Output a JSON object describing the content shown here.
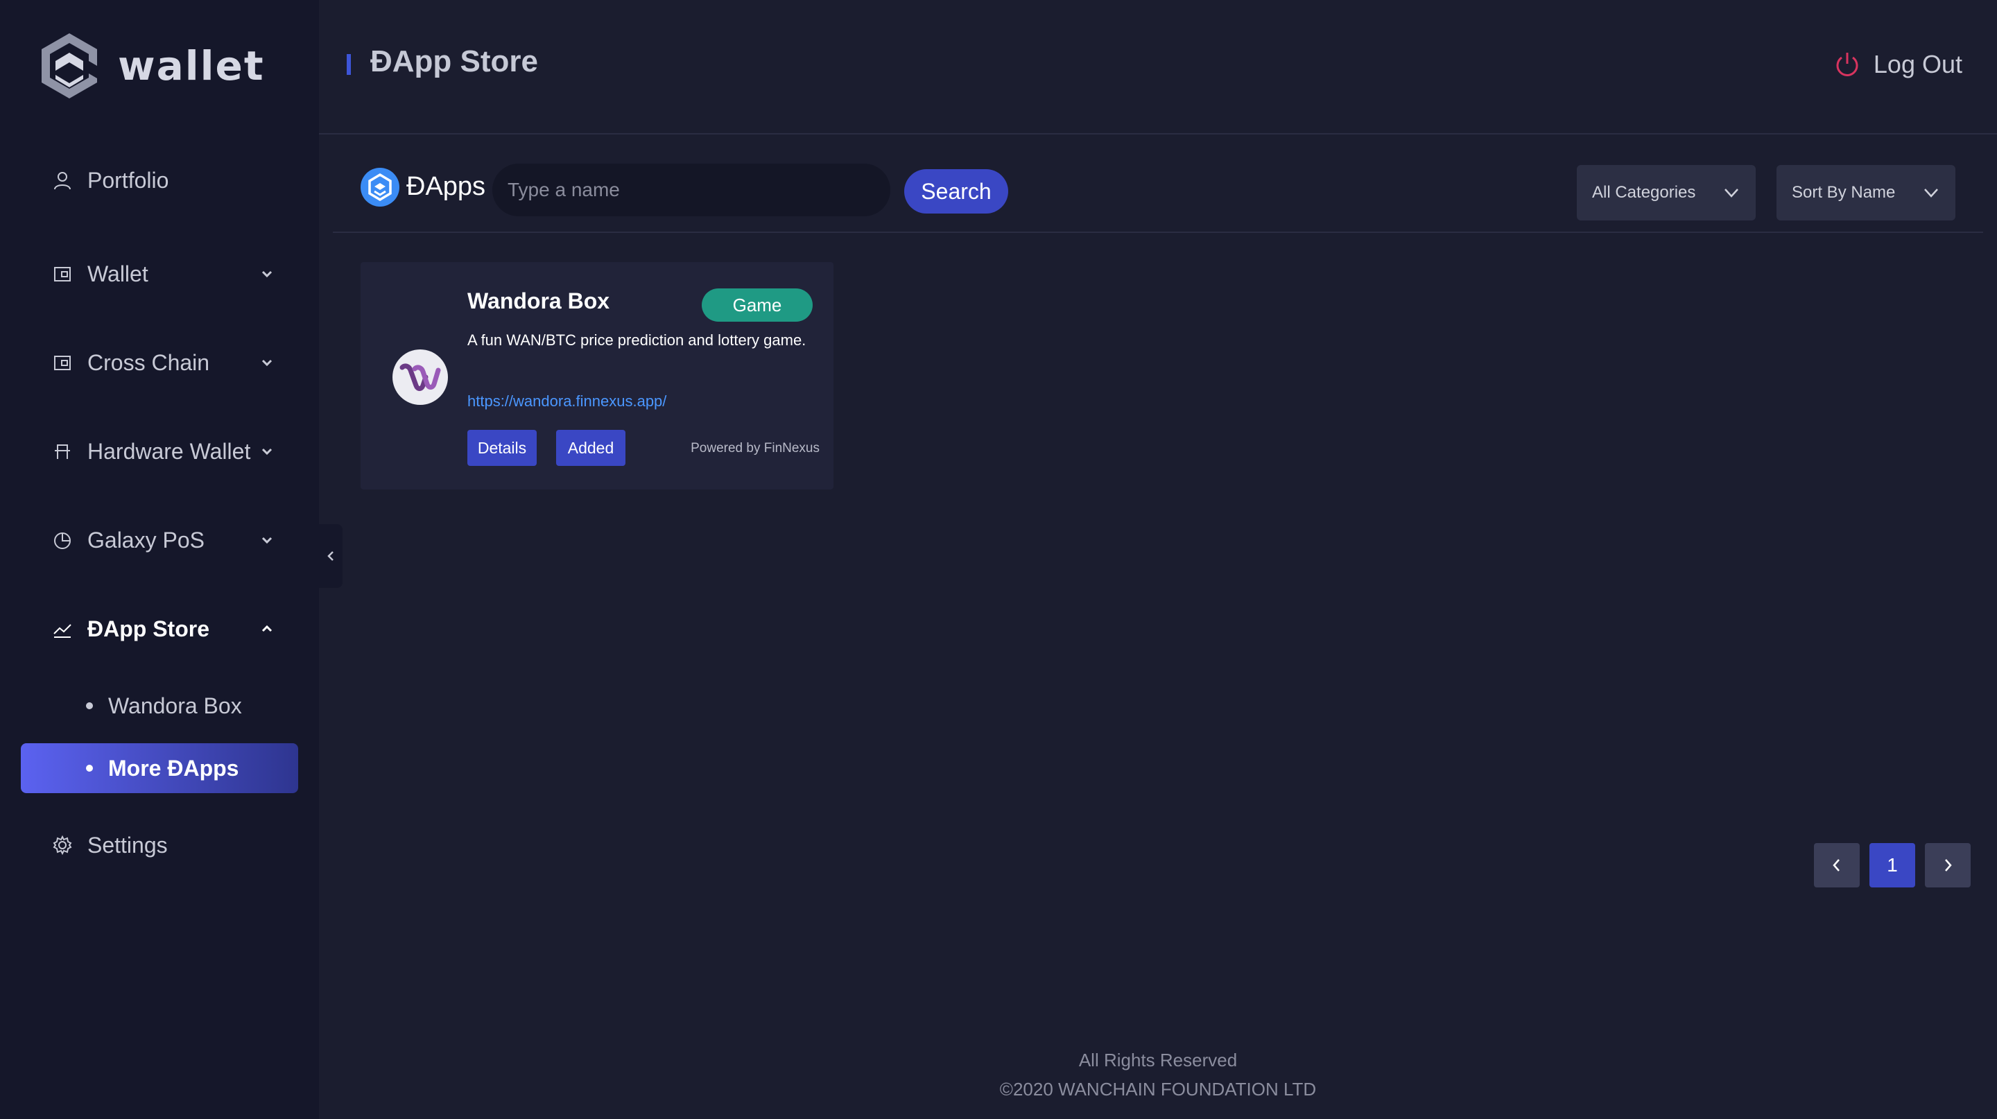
{
  "brand": {
    "name": "wallet"
  },
  "sidebar": {
    "items": [
      {
        "label": "Portfolio",
        "icon": "user-icon"
      },
      {
        "label": "Wallet",
        "icon": "wallet-icon",
        "expanded": false
      },
      {
        "label": "Cross Chain",
        "icon": "cross-chain-icon",
        "expanded": false
      },
      {
        "label": "Hardware Wallet",
        "icon": "hardware-icon",
        "expanded": false
      },
      {
        "label": "Galaxy PoS",
        "icon": "pie-chart-icon",
        "expanded": false
      },
      {
        "label": "ĐApp Store",
        "icon": "chart-line-icon",
        "expanded": true
      },
      {
        "label": "Settings",
        "icon": "gear-icon"
      }
    ],
    "subitems": [
      {
        "label": "Wandora Box",
        "active": false
      },
      {
        "label": "More ĐApps",
        "active": true
      }
    ]
  },
  "header": {
    "title": "ĐApp Store",
    "logout_label": "Log Out"
  },
  "toolbar": {
    "section_label": "ĐApps",
    "search_placeholder": "Type a name",
    "search_value": "",
    "search_button": "Search",
    "category_select": "All Categories",
    "sort_select": "Sort By Name"
  },
  "dapps": [
    {
      "name": "Wandora Box",
      "tag": "Game",
      "description": "A fun WAN/BTC price prediction and lottery game.",
      "url": "https://wandora.finnexus.app/",
      "details_label": "Details",
      "status_label": "Added",
      "powered_by": "Powered by FinNexus"
    }
  ],
  "pagination": {
    "current_page": "1"
  },
  "footer": {
    "rights": "All Rights Reserved",
    "copyright": "©2020 WANCHAIN FOUNDATION LTD"
  },
  "colors": {
    "background": "#1b1d2f",
    "sidebar": "#15172a",
    "accent": "#3a47c4",
    "tag_green": "#1f9a84",
    "logout_red": "#d8345f",
    "link_blue": "#4b97ff"
  }
}
